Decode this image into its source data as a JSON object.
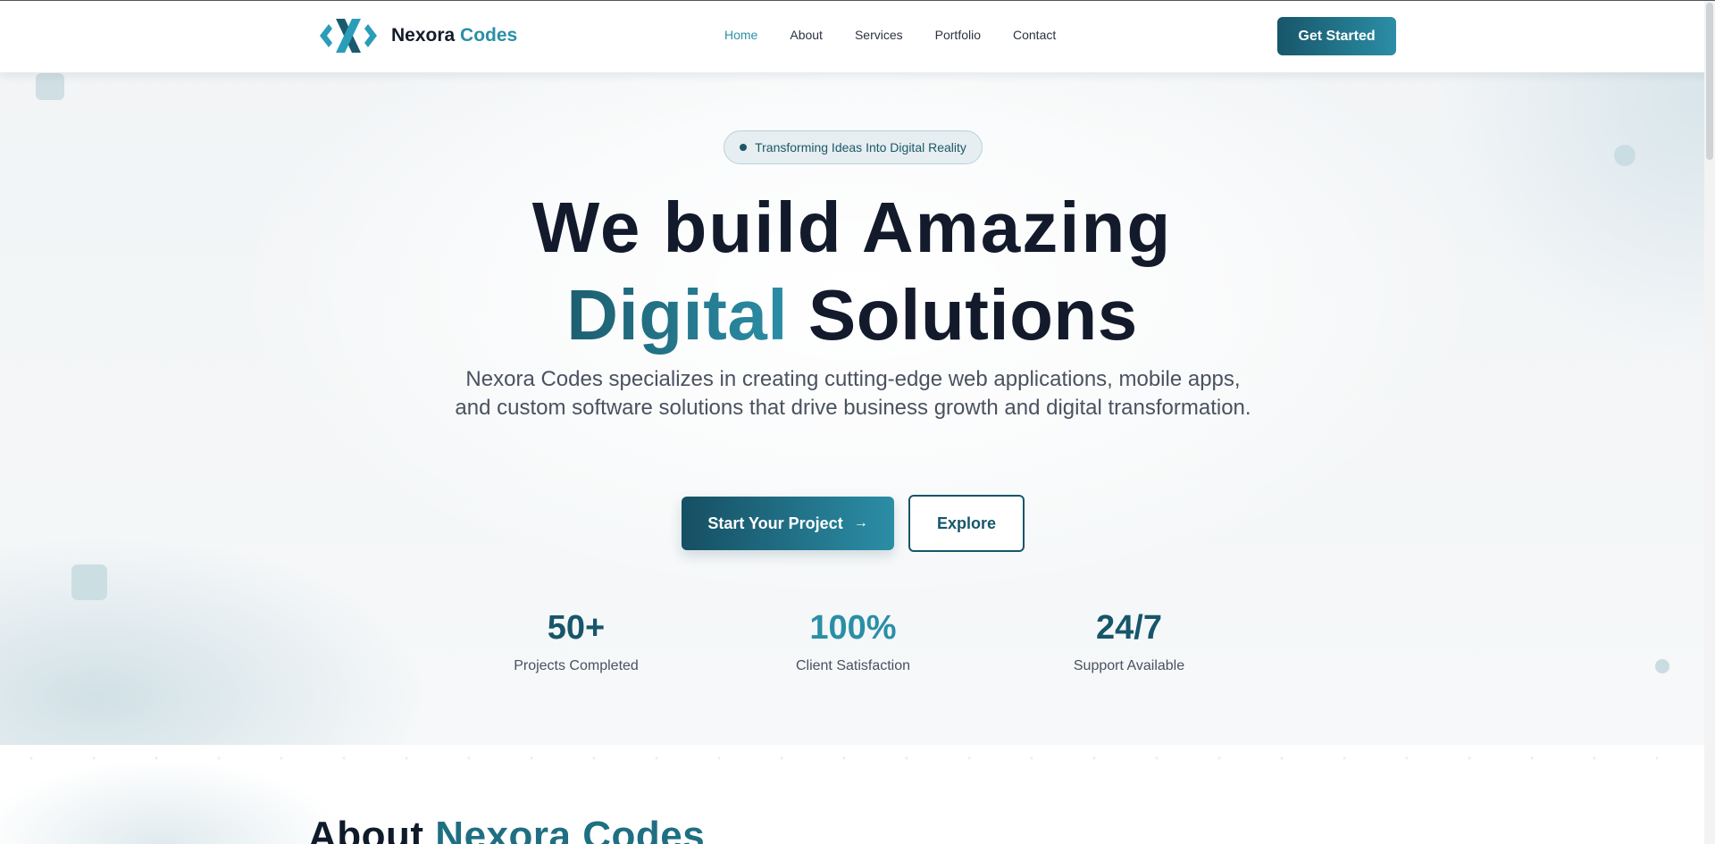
{
  "brand": {
    "name": "Nexora",
    "name_accent": "Codes",
    "accent_color": "#2a8fa6",
    "dark_color": "#17566a"
  },
  "nav": {
    "items": [
      {
        "label": "Home",
        "active": true
      },
      {
        "label": "About",
        "active": false
      },
      {
        "label": "Services",
        "active": false
      },
      {
        "label": "Portfolio",
        "active": false
      },
      {
        "label": "Contact",
        "active": false
      }
    ],
    "cta_label": "Get Started"
  },
  "hero": {
    "tagline": "Transforming Ideas Into Digital Reality",
    "headline_line1": "We build Amazing",
    "headline_accent": "Digital",
    "headline_rest": "Solutions",
    "subtitle": "Nexora Codes specializes in creating cutting-edge web applications, mobile apps, and custom software solutions that drive business growth and digital transformation.",
    "primary_button": "Start Your Project",
    "primary_button_icon": "arrow-right-icon",
    "secondary_button": "Explore",
    "stats": [
      {
        "value": "50+",
        "label": "Projects Completed",
        "color": "#17566a"
      },
      {
        "value": "100%",
        "label": "Client Satisfaction",
        "color": "#2a8fa6"
      },
      {
        "value": "24/7",
        "label": "Support Available",
        "color": "#17566a"
      }
    ]
  },
  "about": {
    "title": "About",
    "title_accent": "Nexora Codes"
  }
}
